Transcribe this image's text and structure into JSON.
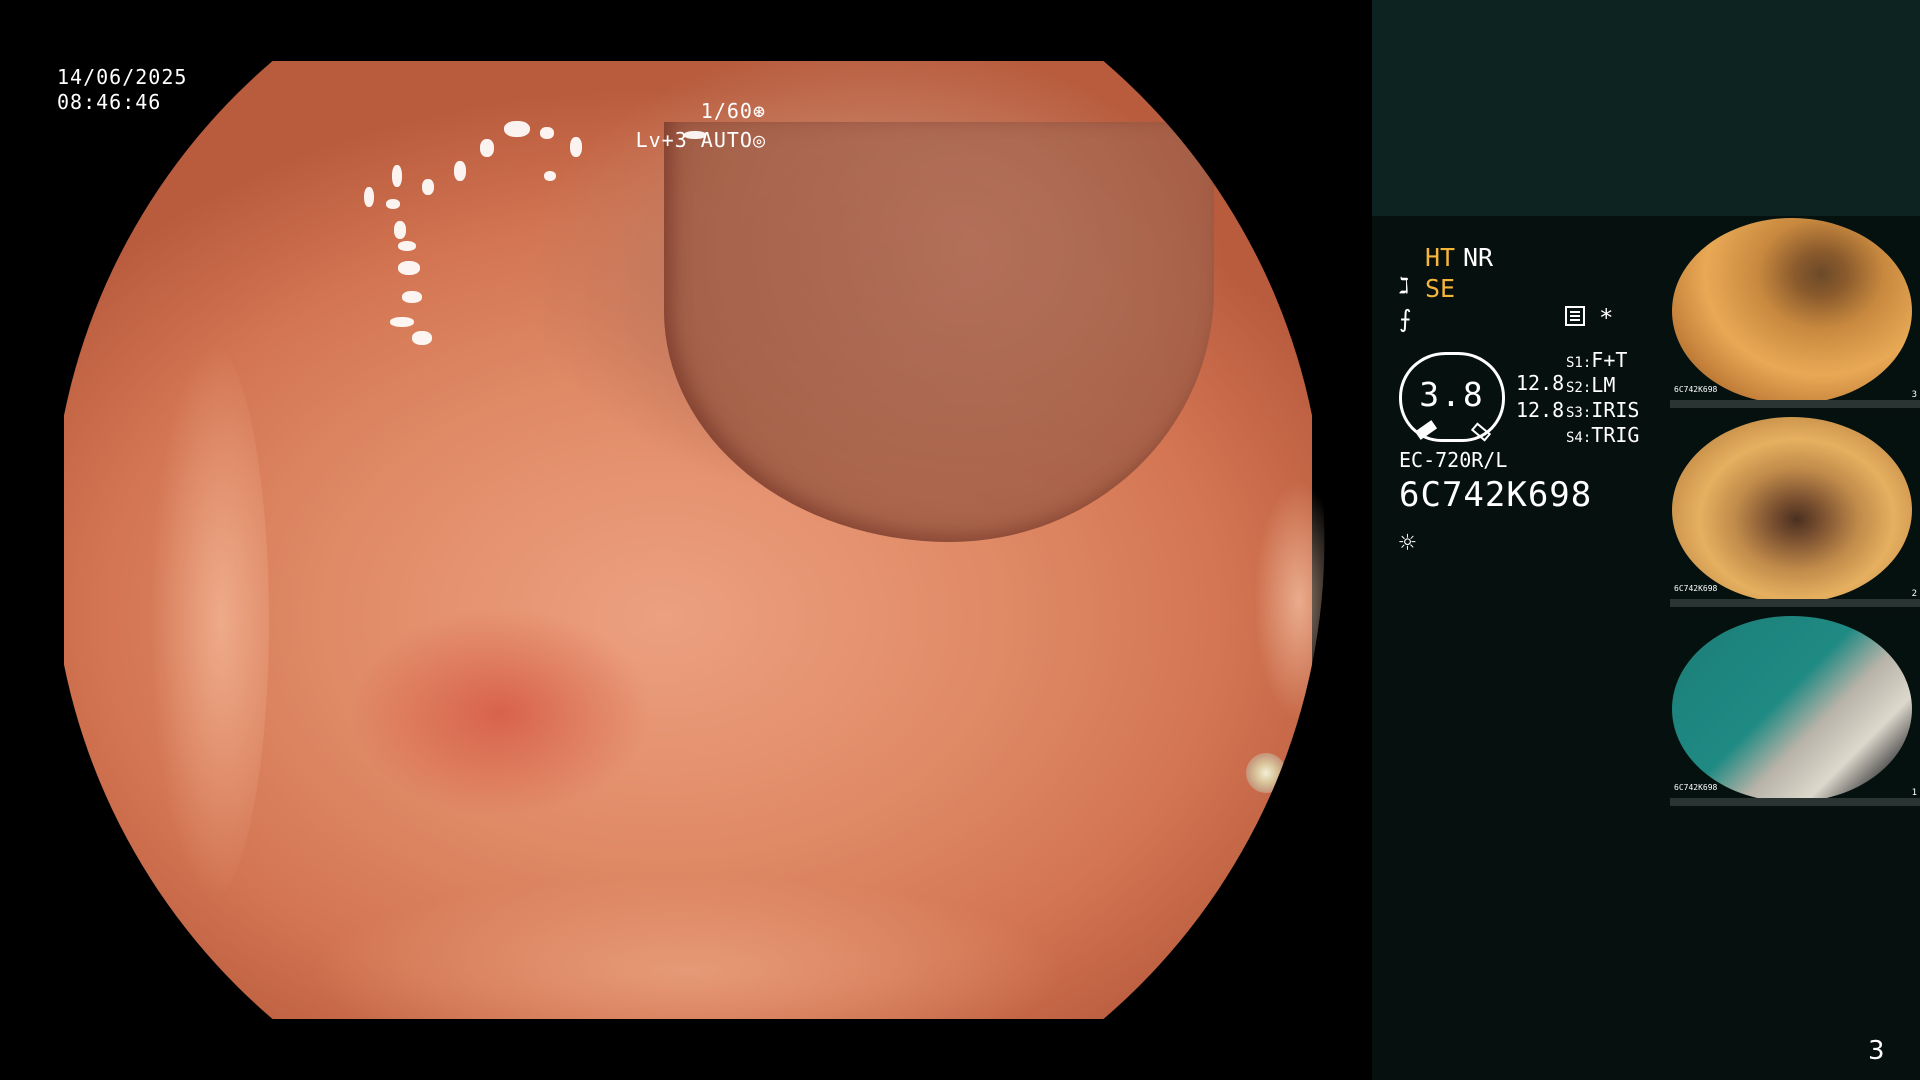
{
  "overlay": {
    "date": "14/06/2025",
    "time": "08:46:46",
    "shutter": "1/60",
    "level": "Lv+3 AUTO",
    "shutter_icon": "aperture-icon",
    "auto_icon": "iris-icon"
  },
  "panel": {
    "mode_ht": "HT",
    "mode_nr": "NR",
    "mode_se": "SE",
    "gauge_value": "3.8",
    "value_1": "12.8",
    "value_2": "12.8",
    "switches": [
      {
        "key": "S1",
        "value": "F+T"
      },
      {
        "key": "S2",
        "value": "LM"
      },
      {
        "key": "S3",
        "value": "IRIS"
      },
      {
        "key": "S4",
        "value": "TRIG"
      }
    ],
    "star": "*",
    "scope_model": "EC-720R/L",
    "serial": "6C742K698",
    "accent_color": "#f5b53b"
  },
  "thumbnails": [
    {
      "index": "3",
      "serial": "6C742K698"
    },
    {
      "index": "2",
      "serial": "6C742K698"
    },
    {
      "index": "1",
      "serial": "6C742K698"
    }
  ],
  "page_number": "3"
}
